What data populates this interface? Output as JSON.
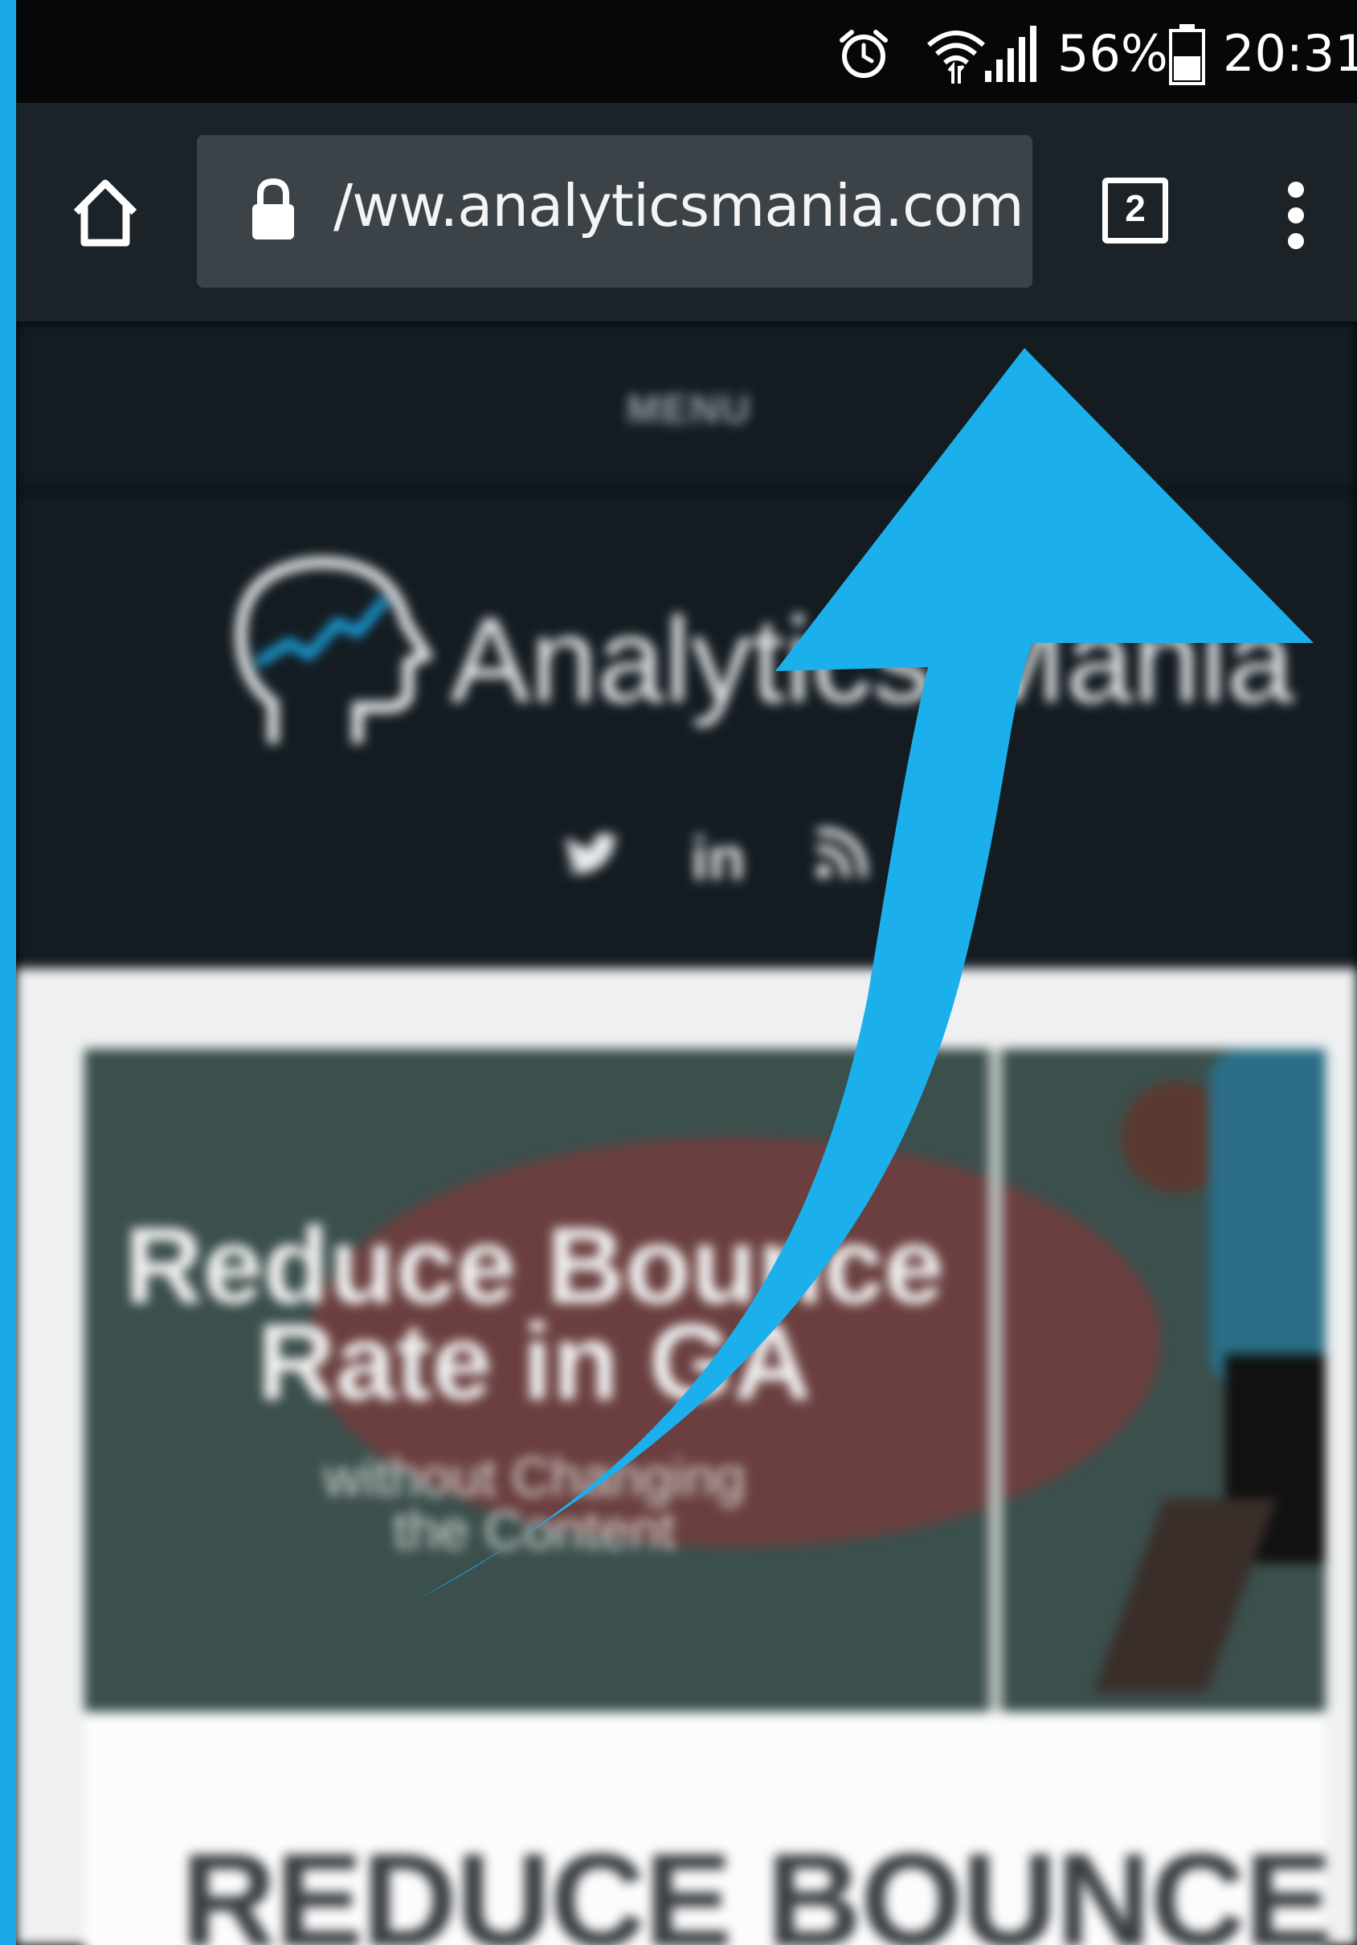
{
  "status_bar": {
    "battery_percent": "56%",
    "time": "20:31",
    "icons": [
      "alarm-icon",
      "wifi-icon",
      "signal-icon",
      "battery-icon"
    ]
  },
  "browser": {
    "url": "/ww.analyticsmania.com",
    "tab_count": "2",
    "icons": [
      "home-icon",
      "lock-icon",
      "tabs-icon",
      "more-icon"
    ]
  },
  "page": {
    "menu_label": "MENU",
    "site_name": "Analytics Mania",
    "social_icons": [
      "twitter-icon",
      "linkedin-icon",
      "rss-icon"
    ],
    "hero": {
      "title_line1": "Reduce Bounce",
      "title_line2": "Rate in GA",
      "subtitle_line1": "without Changing",
      "subtitle_line2": "the Content"
    },
    "article_heading": "REDUCE BOUNCE"
  },
  "colors": {
    "accent": "#1ba8e6",
    "status_bar": "#050708",
    "browser_bar": "#1b2228",
    "url_box": "#3b4248",
    "site_header": "#141c22",
    "content_bg": "#eef0f1"
  }
}
